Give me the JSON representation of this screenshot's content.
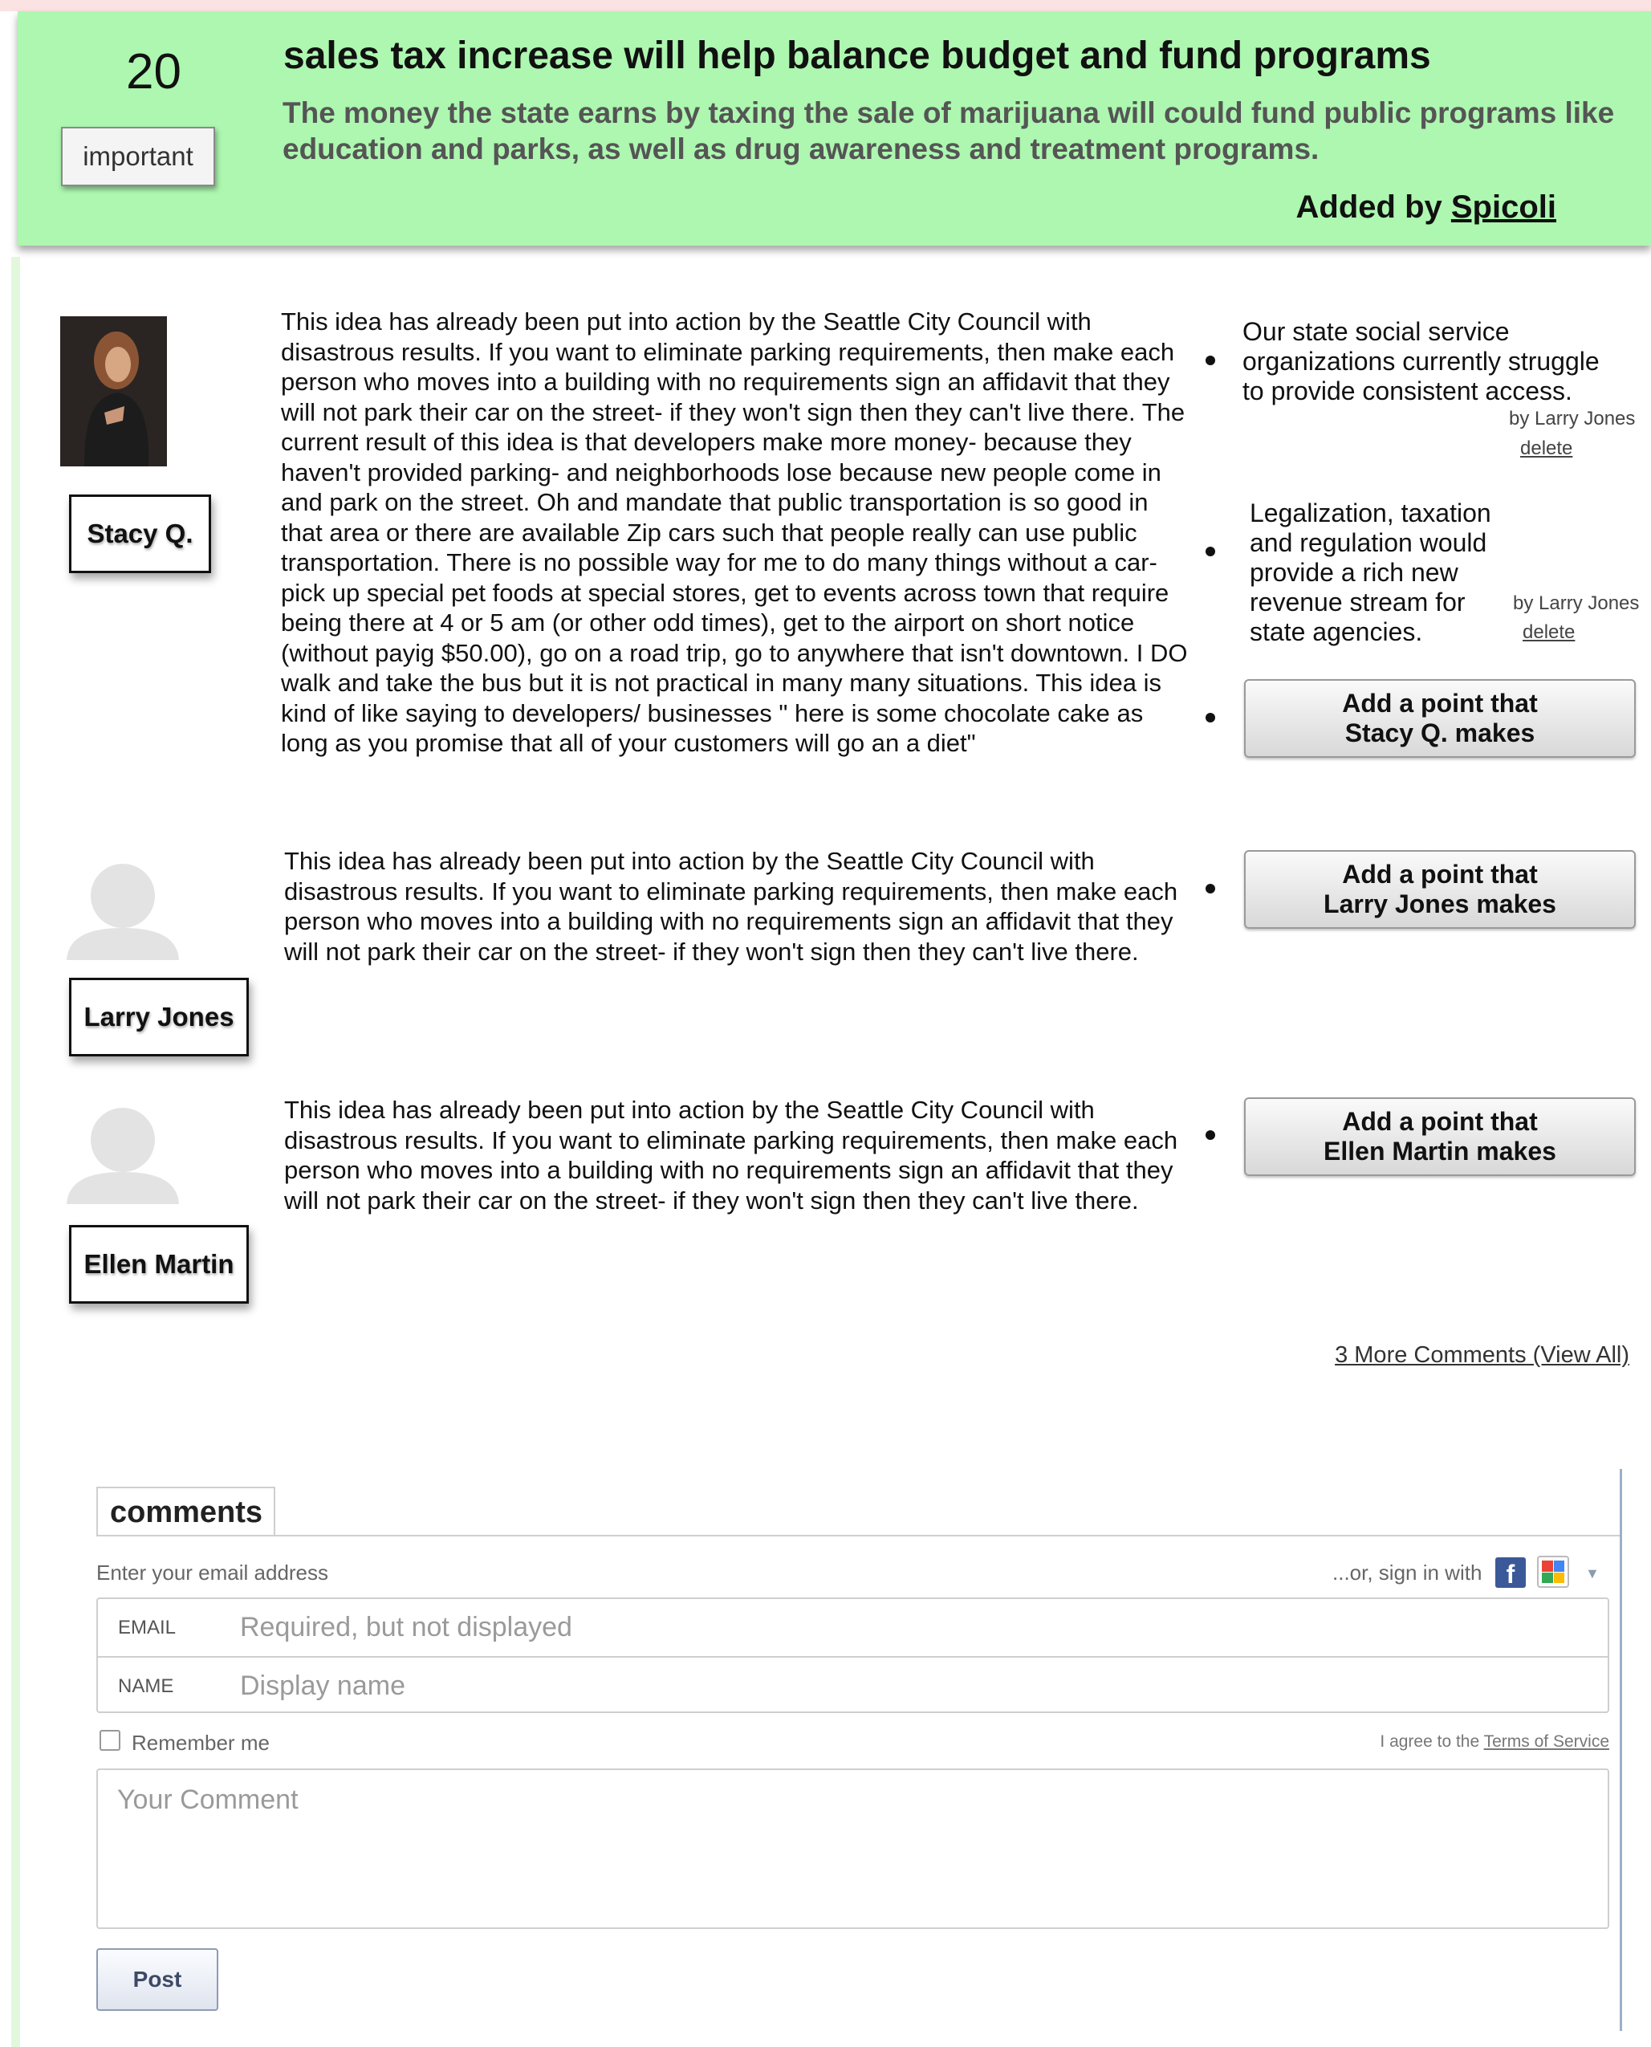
{
  "idea": {
    "votes": "20",
    "important_label": "important",
    "title": "sales tax increase will help balance budget and fund programs",
    "summary": "The money the state earns by taxing the sale of marijuana will could fund public programs like education and parks, as well as drug awareness and treatment programs.",
    "added_by_prefix": "Added by ",
    "added_by_user": "Spicoli"
  },
  "commenters": [
    {
      "name": "Stacy Q.",
      "text": "This idea has already been put into action by the Seattle City Council with disastrous results. If you want to eliminate parking requirements, then make each person who moves into a building with no requirements sign an affidavit that they will not park their car on the street- if they won't sign then they can't live there.  The current result of this idea is that developers make more money- because they haven't provided parking- and neighborhoods lose because new people come in and park on the street. Oh and mandate that public transportation is so good in that area or there are available Zip cars such that people really can use public transportation. There is no possible way for me to do many things without a car- pick up special pet foods at special stores, get to events across town that require being there at 4 or 5 am (or other odd times), get to the airport on short notice (without payig $50.00), go on a road trip, go to anywhere that isn't downtown. I DO walk and take the bus but it is not practical in many many situations. This idea is kind of like saying to developers/ businesses \" here is some chocolate cake as long as you promise that all of your customers will go an a diet\"",
      "add_point_label": "Add a point that Stacy Q. makes"
    },
    {
      "name": "Larry Jones",
      "text": "This idea has already been put into action by the Seattle City Council with disastrous results. If you want to eliminate parking requirements, then make each person who moves into a building with no requirements sign an affidavit that they will not park their car on the street- if they won't sign then they can't live there.",
      "add_point_label": "Add a point that Larry Jones makes"
    },
    {
      "name": "Ellen Martin",
      "text": "This idea has already been put into action by the Seattle City Council with disastrous results. If you want to eliminate parking requirements, then make each person who moves into a building with no requirements sign an affidavit that they will not park their car on the street- if they won't sign then they can't live there.",
      "add_point_label": "Add a point that Ellen Martin makes"
    }
  ],
  "points": [
    {
      "text": "Our state social service organizations currently struggle to provide consistent access.",
      "by": "by Larry Jones",
      "delete_label": "delete"
    },
    {
      "text": "Legalization, taxation and regulation would provide a rich new revenue stream for state agencies.",
      "by": "by Larry Jones",
      "delete_label": "delete"
    }
  ],
  "more_comments_label": "3 More Comments (View All)",
  "comments_widget": {
    "tab_label": "comments",
    "email_prompt": "Enter your email address",
    "signin_label": "...or, sign in with",
    "email_label": "EMAIL",
    "email_placeholder": "Required, but not displayed",
    "name_label": "NAME",
    "name_placeholder": "Display name",
    "remember_label": "Remember me",
    "terms_prefix": "I agree to the ",
    "terms_link": "Terms of Service",
    "comment_placeholder": "Your Comment",
    "post_label": "Post"
  },
  "colors": {
    "header_bg": "#adf7b0",
    "facebook": "#3b5998"
  },
  "icons": [
    "facebook-icon",
    "google-icon",
    "dropdown-caret-icon",
    "default-avatar-icon"
  ]
}
